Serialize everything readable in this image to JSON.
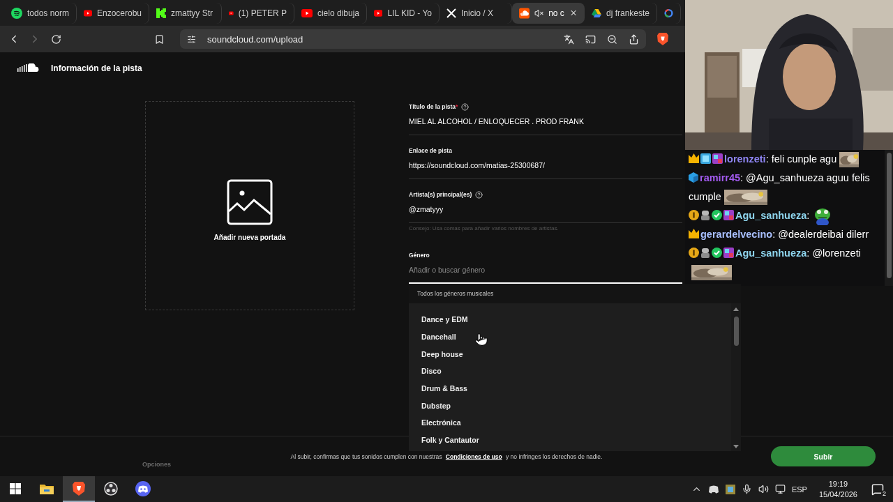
{
  "browser": {
    "tabs": [
      {
        "label": "todos norm",
        "kind": "spotify",
        "selected": false,
        "muted": false
      },
      {
        "label": "Enzocerobu",
        "kind": "youtube",
        "selected": false,
        "muted": false
      },
      {
        "label": "zmattyy Str",
        "kind": "kick",
        "selected": false,
        "muted": false
      },
      {
        "label": "(1) PETER P",
        "kind": "youtube",
        "selected": false,
        "muted": false
      },
      {
        "label": "cielo dibuja",
        "kind": "youtube",
        "selected": false,
        "muted": false
      },
      {
        "label": "LIL KID - Yo",
        "kind": "youtube",
        "selected": false,
        "muted": false
      },
      {
        "label": "Inicio / X",
        "kind": "x",
        "selected": false,
        "muted": false
      },
      {
        "label": "no c",
        "kind": "soundcloud",
        "selected": true,
        "muted": true
      },
      {
        "label": "dj frankeste",
        "kind": "drive",
        "selected": false,
        "muted": false
      },
      {
        "kind": "google",
        "selected": false,
        "muted": false
      }
    ],
    "address": "soundcloud.com/upload",
    "forward_disabled": true
  },
  "page": {
    "title": "Información de la pista",
    "cover": {
      "label": "Añadir nueva portada"
    },
    "fields": [
      {
        "label": "Título de la pista",
        "required_mark": "*",
        "help": true,
        "value": "MIEL AL ALCOHOL / ENLOQUECER . PROD FRANK"
      },
      {
        "label": "Enlace de pista",
        "help": false,
        "value": "https://soundcloud.com/matias-25300687/"
      },
      {
        "label": "Artista(s) principal(es)",
        "help": true,
        "value": "@zmatyyy",
        "hint": "Consejo: Usa comas para añadir varios nombres de artistas."
      },
      {
        "label": "Género",
        "help": false,
        "placeholder": "Añadir o buscar género",
        "focused": true
      }
    ],
    "genre_dropdown": {
      "heading": "Todos los géneros musicales",
      "items": [
        "Dance y EDM",
        "Dancehall",
        "Deep house",
        "Disco",
        "Drum & Bass",
        "Dubstep",
        "Electrónica",
        "Folk y Cantautor"
      ]
    },
    "footer": {
      "options_label": "Opciones",
      "consent": "Al subir, confirmas que tus sonidos cumplen con nuestras",
      "link": "Condiciones de uso",
      "consent_end": "y no infringes los derechos de nadie.",
      "submit": "Subir"
    }
  },
  "webcam": {
    "kind": "picture"
  },
  "chat": {
    "messages": [
      {
        "badges": [
          {
            "kind": "crown"
          },
          {
            "kind": "gem"
          },
          {
            "kind": "tile"
          }
        ],
        "user": "lorenzeti",
        "color": "#8f86f5",
        "parts": [
          {
            "kind": "text",
            "text": ": feli cunple agu"
          },
          {
            "kind": "picture"
          }
        ]
      },
      {
        "badges": [
          {
            "kind": "cube"
          }
        ],
        "user": "ramirr45",
        "color": "#a35bf0",
        "parts": [
          {
            "kind": "text",
            "text": ": @Agu_sanhueza aguu felis cumple"
          },
          {
            "kind": "picture"
          }
        ]
      },
      {
        "badges": [
          {
            "kind": "medal"
          },
          {
            "kind": "robot"
          },
          {
            "kind": "check"
          },
          {
            "kind": "tile"
          }
        ],
        "user": "Agu_sanhueza",
        "color": "#8fd6ef",
        "parts": [
          {
            "kind": "text",
            "text": ":"
          },
          {
            "kind": "picture"
          }
        ]
      },
      {
        "badges": [
          {
            "kind": "crown"
          }
        ],
        "user": "gerardelvecino",
        "color": "#a9c0ff",
        "parts": [
          {
            "kind": "text",
            "text": ": @dealerdeibai dilerr"
          }
        ]
      },
      {
        "badges": [
          {
            "kind": "medal"
          },
          {
            "kind": "robot"
          },
          {
            "kind": "check"
          },
          {
            "kind": "tile"
          }
        ],
        "user": "Agu_sanhueza",
        "color": "#8fd6ef",
        "parts": [
          {
            "kind": "text",
            "text": ": @lorenzeti"
          },
          {
            "kind": "picture"
          }
        ]
      }
    ]
  },
  "taskbar": {
    "apps": [
      {
        "kind": "start",
        "selected": false
      },
      {
        "kind": "explorer",
        "selected": false
      },
      {
        "kind": "brave",
        "selected": true
      },
      {
        "kind": "obs",
        "selected": false
      },
      {
        "kind": "discord",
        "selected": false
      }
    ],
    "language": "ESP",
    "time": "19:19",
    "date": "15/04/2026",
    "notifications": "2"
  }
}
